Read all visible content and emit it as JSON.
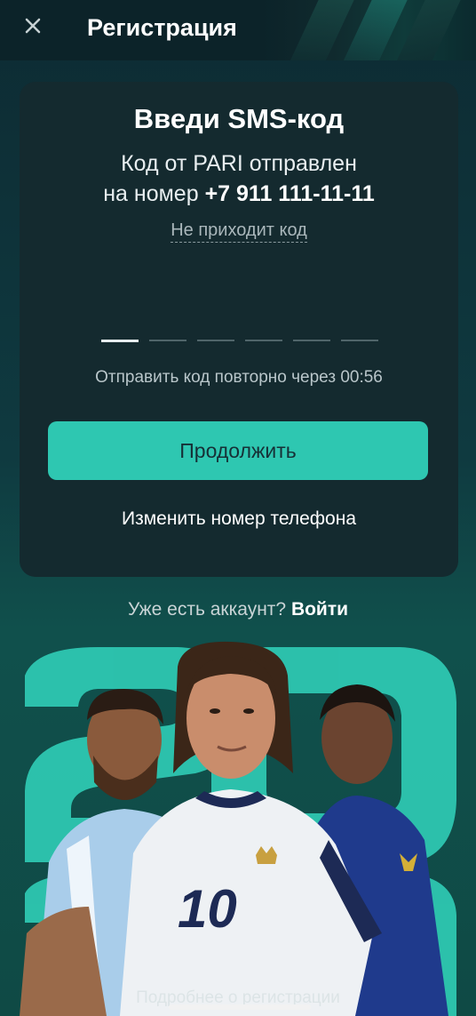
{
  "header": {
    "title": "Регистрация",
    "close_icon": "close-icon"
  },
  "card": {
    "heading": "Введи SMS-код",
    "sent_line1": "Код от PARI отправлен",
    "sent_line2_prefix": "на номер ",
    "phone": "+7 911 111-11-11",
    "no_code_link": "Не приходит код",
    "code_slots": 6,
    "resend_text": "Отправить код повторно через 00:56",
    "continue_label": "Продолжить",
    "change_phone_label": "Изменить номер телефона"
  },
  "footer": {
    "have_account": "Уже есть аккаунт?",
    "login_label": "Войти",
    "bottom_text": "Подробнее о регистрации"
  },
  "promo": {
    "jersey_number": "10",
    "background_digits": "2022"
  },
  "colors": {
    "accent": "#2ec7b1",
    "card": "#142a2f",
    "background": "#0f3a40"
  }
}
